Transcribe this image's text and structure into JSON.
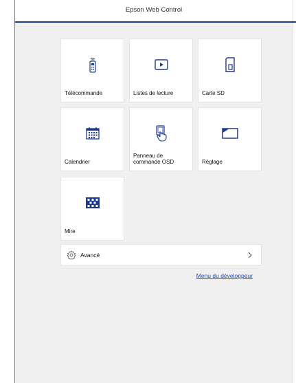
{
  "header": {
    "title": "Epson Web Control"
  },
  "tiles": [
    {
      "label": "Télécommande",
      "icon": "remote-control-icon"
    },
    {
      "label": "Listes de lecture",
      "icon": "play-icon"
    },
    {
      "label": "Carte SD",
      "icon": "sd-card-icon"
    },
    {
      "label": "Calendrier",
      "icon": "calendar-icon"
    },
    {
      "label": "Panneau de commande OSD",
      "icon": "touch-hand-icon"
    },
    {
      "label": "Réglage",
      "icon": "screen-icon"
    },
    {
      "label": "Mire",
      "icon": "test-pattern-icon"
    }
  ],
  "advanced": {
    "label": "Avancé",
    "icon": "gear-icon",
    "chevron": "chevron-right-icon"
  },
  "developer_link": "Menu du développeur",
  "colors": {
    "accent": "#1c3a8c",
    "link": "#1e4fb0",
    "background": "#f0f0f0",
    "edge": "#4a7fd0"
  }
}
